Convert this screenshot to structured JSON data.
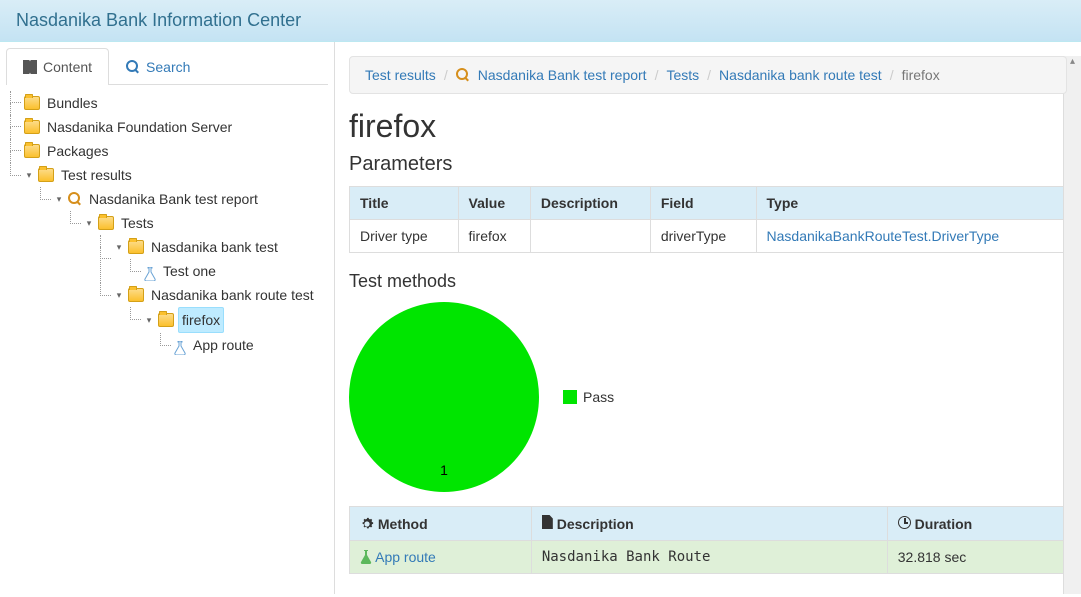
{
  "header": {
    "title": "Nasdanika Bank Information Center"
  },
  "tabs": {
    "content": "Content",
    "search": "Search"
  },
  "tree": {
    "bundles": "Bundles",
    "nfs": "Nasdanika Foundation Server",
    "packages": "Packages",
    "test_results": "Test results",
    "report": "Nasdanika Bank test report",
    "tests": "Tests",
    "nbt": "Nasdanika bank test",
    "test_one": "Test one",
    "nbrt": "Nasdanika bank route test",
    "firefox": "firefox",
    "app_route": "App route"
  },
  "breadcrumb": {
    "test_results": "Test results",
    "report": "Nasdanika Bank test report",
    "tests": "Tests",
    "nbrt": "Nasdanika bank route test",
    "current": "firefox"
  },
  "page": {
    "title": "firefox",
    "parameters_h": "Parameters",
    "test_methods_h": "Test methods"
  },
  "param_table": {
    "headers": {
      "title": "Title",
      "value": "Value",
      "description": "Description",
      "field": "Field",
      "type": "Type"
    },
    "row": {
      "title": "Driver type",
      "value": "firefox",
      "description": "",
      "field": "driverType",
      "type": "NasdanikaBankRouteTest.DriverType"
    }
  },
  "chart_data": {
    "type": "pie",
    "title": "",
    "series": [
      {
        "name": "Pass",
        "value": 1,
        "color": "#00e500"
      }
    ],
    "legend": [
      "Pass"
    ]
  },
  "methods_table": {
    "headers": {
      "method": "Method",
      "description": "Description",
      "duration": "Duration"
    },
    "row": {
      "method": "App route",
      "description": "Nasdanika Bank Route",
      "duration": "32.818 sec"
    }
  }
}
